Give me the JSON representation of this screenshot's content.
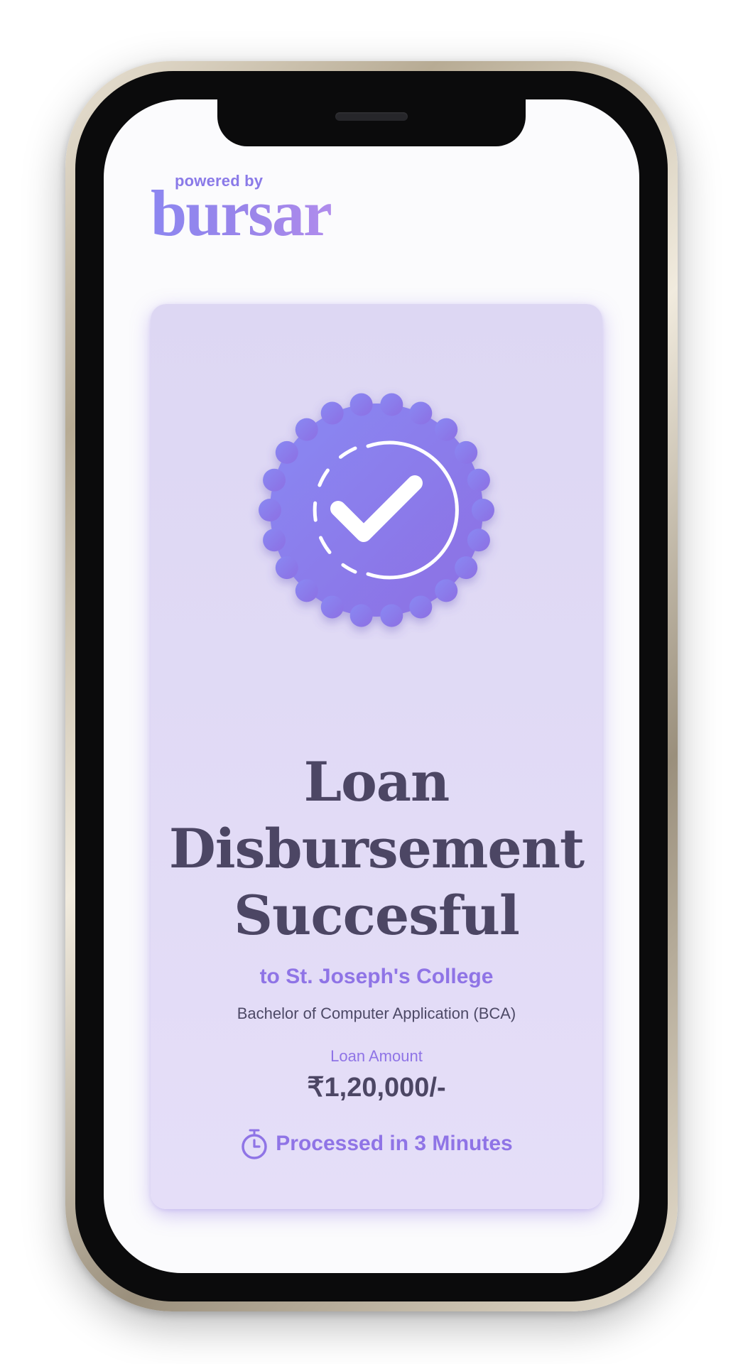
{
  "brand": {
    "powered_by": "powered by",
    "name": "bursar",
    "gradient_colors": [
      "#8c86f0",
      "#b08cec"
    ]
  },
  "card": {
    "badge_icon": "verified-check-badge-icon",
    "title_lines": [
      "Loan",
      "Disbursement",
      "Succesful"
    ],
    "subtitle": "to St. Joseph's College",
    "course": "Bachelor of Computer Application (BCA)",
    "amount_label": "Loan Amount",
    "amount": "₹1,20,000/-",
    "processed_icon": "stopwatch-icon",
    "processed_text": "Processed in 3 Minutes"
  },
  "colors": {
    "accent": "#8f74e6",
    "heading": "#4c4664",
    "card_background": "#e2dcf6",
    "badge_gradient": [
      "#8a89f3",
      "#8c6fe3"
    ]
  }
}
